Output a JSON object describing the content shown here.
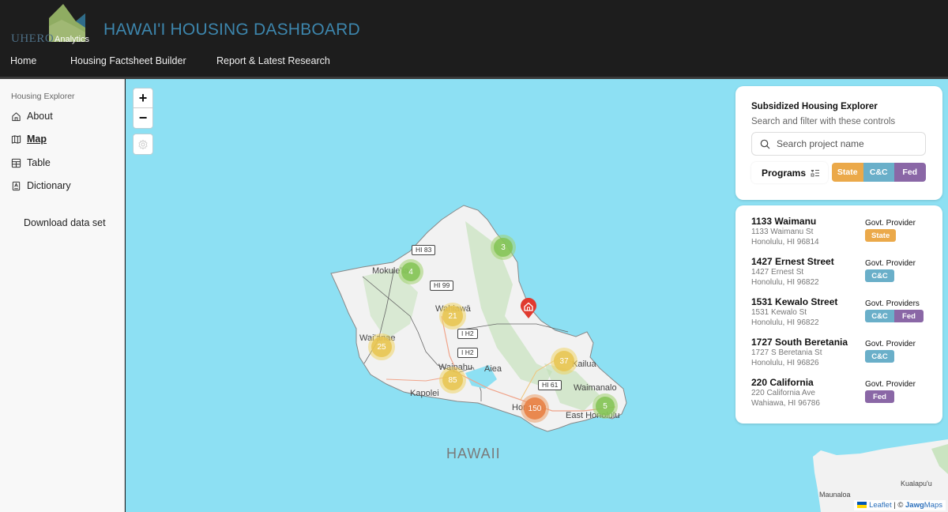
{
  "header": {
    "logo_uhero": "UHERO",
    "logo_analytics": "Analytics",
    "title": "HAWAI'I HOUSING DASHBOARD",
    "nav": [
      {
        "label": "Home"
      },
      {
        "label": "Housing Factsheet Builder"
      },
      {
        "label": "Report & Latest Research"
      }
    ]
  },
  "sidebar": {
    "heading": "Housing Explorer",
    "items": [
      {
        "label": "About",
        "icon": "home-icon",
        "active": false
      },
      {
        "label": "Map",
        "icon": "map-icon",
        "active": true
      },
      {
        "label": "Table",
        "icon": "table-icon",
        "active": false
      },
      {
        "label": "Dictionary",
        "icon": "dictionary-icon",
        "active": false
      }
    ],
    "download_label": "Download data set"
  },
  "map": {
    "zoom_in": "+",
    "zoom_out": "−",
    "region_label": "HAWAII",
    "place_labels": [
      "Mokuleʻia",
      "Wahiawā",
      "Waiʻanae",
      "Waipahu",
      "Aiea",
      "Kapolei",
      "Kailua",
      "Waimanalo",
      "Honolulu",
      "East Honolulu",
      "Maunaloa",
      "Kualapu'u"
    ],
    "road_shields": [
      "HI 83",
      "HI 99",
      "I H2",
      "I H2",
      "HI 61"
    ],
    "clusters": [
      {
        "count": "3",
        "color": "green"
      },
      {
        "count": "4",
        "color": "green"
      },
      {
        "count": "21",
        "color": "yellow"
      },
      {
        "count": "25",
        "color": "yellow"
      },
      {
        "count": "37",
        "color": "yellow"
      },
      {
        "count": "85",
        "color": "yellow"
      },
      {
        "count": "150",
        "color": "orange"
      },
      {
        "count": "5",
        "color": "green"
      }
    ],
    "attribution": {
      "leaflet": "Leaflet",
      "sep": "|",
      "copyright": "©",
      "jawg_bold": "Jawg",
      "jawg_rest": "Maps"
    }
  },
  "filter_panel": {
    "title": "Subsidized Housing Explorer",
    "subtitle": "Search and filter with these controls",
    "search_placeholder": "Search project name",
    "search_value": "",
    "programs_label": "Programs",
    "segments": [
      {
        "label": "State",
        "color": "#eba94a"
      },
      {
        "label": "C&C",
        "color": "#6aafc9"
      },
      {
        "label": "Fed",
        "color": "#8a67a6"
      }
    ]
  },
  "colors": {
    "state": "#eba94a",
    "cc": "#6aafc9",
    "fed": "#8a67a6",
    "water": "#8de0f3",
    "title_blue": "#3d86ad"
  },
  "listings": [
    {
      "name": "1133 Waimanu",
      "street": "1133 Waimanu St",
      "city": "Honolulu, HI 96814",
      "provider_label": "Govt. Provider",
      "badges": [
        "State"
      ]
    },
    {
      "name": "1427 Ernest Street",
      "street": "1427 Ernest St",
      "city": "Honolulu, HI 96822",
      "provider_label": "Govt. Provider",
      "badges": [
        "C&C"
      ]
    },
    {
      "name": "1531 Kewalo Street",
      "street": "1531 Kewalo St",
      "city": "Honolulu, HI 96822",
      "provider_label": "Govt. Providers",
      "badges": [
        "C&C",
        "Fed"
      ]
    },
    {
      "name": "1727 South Beretania",
      "street": "1727 S Beretania St",
      "city": "Honolulu, HI 96826",
      "provider_label": "Govt. Provider",
      "badges": [
        "C&C"
      ]
    },
    {
      "name": "220 California",
      "street": "220 California Ave",
      "city": "Wahiawa, HI 96786",
      "provider_label": "Govt. Provider",
      "badges": [
        "Fed"
      ]
    }
  ]
}
